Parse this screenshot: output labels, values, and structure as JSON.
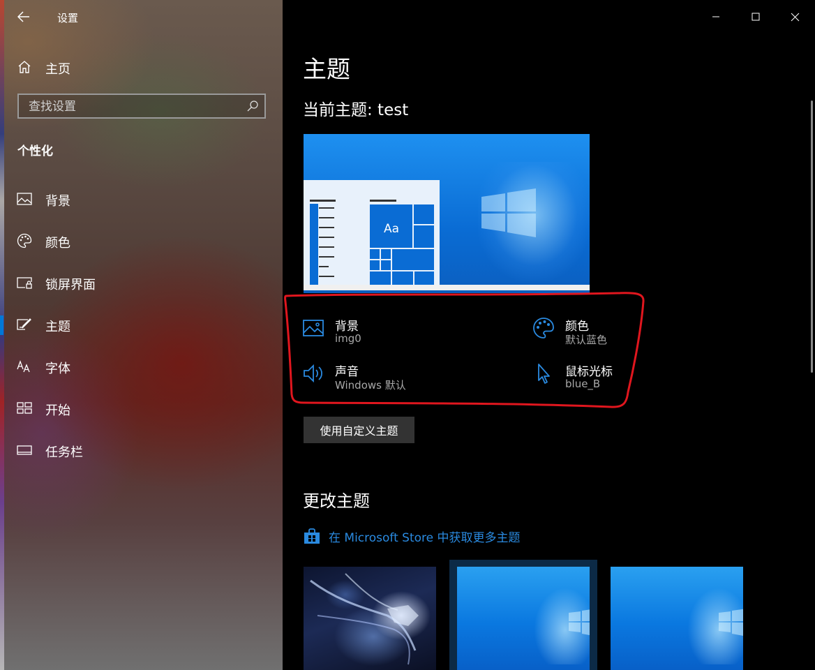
{
  "app": {
    "title": "设置"
  },
  "nav": {
    "home_label": "主页",
    "search_placeholder": "查找设置",
    "section_header": "个性化",
    "items": [
      {
        "label": "背景",
        "icon": "picture-icon",
        "active": false
      },
      {
        "label": "颜色",
        "icon": "palette-icon",
        "active": false
      },
      {
        "label": "锁屏界面",
        "icon": "lock-screen-icon",
        "active": false
      },
      {
        "label": "主题",
        "icon": "theme-icon",
        "active": true
      },
      {
        "label": "字体",
        "icon": "font-icon",
        "active": false
      },
      {
        "label": "开始",
        "icon": "start-icon",
        "active": false
      },
      {
        "label": "任务栏",
        "icon": "taskbar-icon",
        "active": false
      }
    ]
  },
  "window_controls": [
    "minimize",
    "maximize",
    "close"
  ],
  "main": {
    "page_title": "主题",
    "current_theme": "当前主题: test",
    "preview_tile_text": "Aa",
    "theme_details": [
      {
        "title": "背景",
        "value": "img0",
        "icon": "picture-icon"
      },
      {
        "title": "颜色",
        "value": "默认蓝色",
        "icon": "palette-icon"
      },
      {
        "title": "声音",
        "value": "Windows 默认",
        "icon": "speaker-icon"
      },
      {
        "title": "鼠标光标",
        "value": "blue_B",
        "icon": "cursor-icon"
      }
    ],
    "custom_theme_button": "使用自定义主题",
    "change_theme_title": "更改主题",
    "store_link": "在 Microsoft Store 中获取更多主题"
  },
  "colors": {
    "accent": "#0078d7",
    "link": "#2a8ae0",
    "highlight_annotation": "#e0161e",
    "secondary_text": "#a8a8a8",
    "button_bg": "#333333"
  }
}
